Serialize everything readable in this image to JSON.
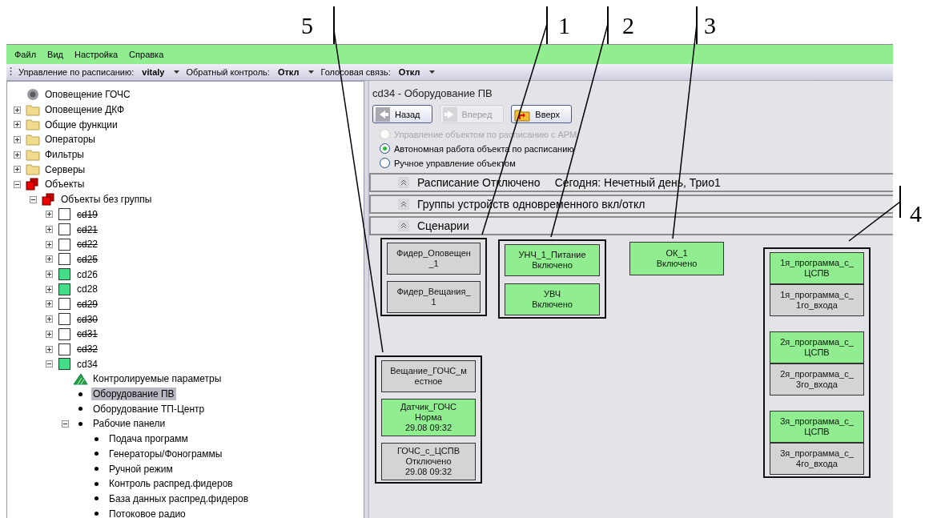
{
  "menu": [
    "Файл",
    "Вид",
    "Настройка",
    "Справка"
  ],
  "toolbar": [
    {
      "label": "Управление по расписанию:",
      "value": "vitaly"
    },
    {
      "label": "Обратный контроль:",
      "value": "Откл"
    },
    {
      "label": "Голосовая связь:",
      "value": "Откл"
    }
  ],
  "tree": [
    {
      "label": "Оповещение ГОЧС",
      "kind": "speaker",
      "selected": false
    },
    {
      "label": "Оповещение ДКФ",
      "kind": "folder",
      "expanded": false,
      "selected": false
    },
    {
      "label": "Общие функции",
      "kind": "folder",
      "expanded": false,
      "selected": false
    },
    {
      "label": "Операторы",
      "kind": "folder",
      "expanded": false,
      "selected": false
    },
    {
      "label": "Фильтры",
      "kind": "folder",
      "expanded": false,
      "selected": false
    },
    {
      "label": "Серверы",
      "kind": "folder",
      "expanded": false,
      "selected": false
    },
    {
      "label": "Объекты",
      "kind": "cubes",
      "expanded": true,
      "selected": false,
      "children": [
        {
          "label": "Объекты без группы",
          "kind": "cubes",
          "expanded": true,
          "selected": false,
          "children": [
            {
              "label": "cd19",
              "kind": "square",
              "color": "#ffffff",
              "disabled": true,
              "expanded": false,
              "selected": false
            },
            {
              "label": "cd21",
              "kind": "square",
              "color": "#ffffff",
              "disabled": true,
              "expanded": false,
              "selected": false
            },
            {
              "label": "cd22",
              "kind": "square",
              "color": "#ffffff",
              "disabled": true,
              "expanded": false,
              "selected": false
            },
            {
              "label": "cd25",
              "kind": "square",
              "color": "#ffffff",
              "disabled": true,
              "expanded": false,
              "selected": false
            },
            {
              "label": "cd26",
              "kind": "square",
              "color": "#44dd88",
              "disabled": false,
              "expanded": false,
              "selected": false
            },
            {
              "label": "cd28",
              "kind": "square",
              "color": "#44dd88",
              "disabled": false,
              "expanded": false,
              "selected": false
            },
            {
              "label": "cd29",
              "kind": "square",
              "color": "#ffffff",
              "disabled": true,
              "expanded": false,
              "selected": false
            },
            {
              "label": "cd30",
              "kind": "square",
              "color": "#ffffff",
              "disabled": true,
              "expanded": false,
              "selected": false
            },
            {
              "label": "cd31",
              "kind": "square",
              "color": "#ffffff",
              "disabled": true,
              "expanded": false,
              "selected": false
            },
            {
              "label": "cd32",
              "kind": "square",
              "color": "#ffffff",
              "disabled": true,
              "expanded": false,
              "selected": false
            },
            {
              "label": "cd34",
              "kind": "square",
              "color": "#44dd88",
              "disabled": false,
              "expanded": true,
              "selected": false,
              "children": [
                {
                  "label": "Контролируемые параметры",
                  "kind": "params",
                  "selected": false
                },
                {
                  "label": "Оборудование ПВ",
                  "kind": "bullet",
                  "selected": true
                },
                {
                  "label": "Оборудование ТП-Центр",
                  "kind": "bullet",
                  "selected": false
                },
                {
                  "label": "Рабочие панели",
                  "kind": "bullet",
                  "expanded": true,
                  "selected": false,
                  "children": [
                    {
                      "label": "Подача программ",
                      "kind": "bullet",
                      "selected": false
                    },
                    {
                      "label": "Генераторы/Фонограммы",
                      "kind": "bullet",
                      "selected": false
                    },
                    {
                      "label": "Ручной режим",
                      "kind": "bullet",
                      "selected": false
                    },
                    {
                      "label": "Контроль распред.фидеров",
                      "kind": "bullet",
                      "selected": false
                    },
                    {
                      "label": "База данных распред.фидеров",
                      "kind": "bullet",
                      "selected": false
                    },
                    {
                      "label": "Потоковое радио",
                      "kind": "bullet",
                      "selected": false
                    }
                  ]
                }
              ]
            }
          ]
        }
      ]
    }
  ],
  "panel": {
    "title": "cd34 - Оборудование ПВ",
    "nav_buttons": [
      {
        "kind": "back",
        "label": "Назад",
        "disabled": false
      },
      {
        "kind": "forward",
        "label": "Вперед",
        "disabled": true
      },
      {
        "kind": "up",
        "label": "Вверх",
        "disabled": false
      }
    ],
    "modes": [
      {
        "label": "Управление объектом по расписанию с АРМ",
        "selected": false,
        "disabled": true
      },
      {
        "label": "Автономная работа объекта по расписанию",
        "selected": true,
        "disabled": false
      },
      {
        "label": "Ручное управление объектом",
        "selected": false,
        "disabled": false
      }
    ],
    "sections": [
      {
        "title": "Расписание Отключено",
        "info": "Сегодня: Нечетный день, Трио1"
      },
      {
        "title": "Группы устройств одновременного вкл/откл"
      },
      {
        "title": "Сценарии"
      }
    ],
    "device_groups": [
      {
        "framed": true,
        "stacks": [
          [
            {
              "lines": [
                "Фидер_Оповещен",
                "_1"
              ],
              "on": false
            }
          ],
          [
            {
              "lines": [
                "Фидер_Вещания_",
                "1"
              ],
              "on": false
            }
          ]
        ]
      },
      {
        "framed": true,
        "stacks": [
          [
            {
              "lines": [
                "УНЧ_1_Питание",
                "Включено"
              ],
              "on": true
            }
          ],
          [
            {
              "lines": [
                "УВЧ",
                "Включено"
              ],
              "on": true
            }
          ]
        ]
      },
      {
        "framed": false,
        "stacks": [
          [
            {
              "lines": [
                "ОК_1",
                "Включено"
              ],
              "on": true
            }
          ]
        ]
      },
      {
        "framed": true,
        "stacks": [
          [
            {
              "lines": [
                "1я_программа_с_",
                "ЦСПВ"
              ],
              "on": true
            },
            {
              "lines": [
                "1я_программа_с_",
                "1го_входа"
              ],
              "on": false
            }
          ],
          [
            {
              "lines": [
                "2я_программа_с_",
                "ЦСПВ"
              ],
              "on": true
            },
            {
              "lines": [
                "2я_программа_с_",
                "3го_входа"
              ],
              "on": false
            }
          ],
          [
            {
              "lines": [
                "3я_программа_с_",
                "ЦСПВ"
              ],
              "on": true
            },
            {
              "lines": [
                "3я_программа_с_",
                "4го_входа"
              ],
              "on": false
            }
          ]
        ]
      },
      {
        "framed": true,
        "stacks": [
          [
            {
              "lines": [
                "Вещание_ГОЧС_м",
                "естное"
              ],
              "on": false
            }
          ],
          [
            {
              "lines": [
                "Датчик_ГОЧС",
                "Норма",
                "29.08 09:32"
              ],
              "on": true
            }
          ],
          [
            {
              "lines": [
                "ГОЧС_с_ЦСПВ",
                "Отключено",
                "29.08 09:32"
              ],
              "on": false
            }
          ]
        ]
      }
    ]
  },
  "callouts": [
    {
      "label": "5"
    },
    {
      "label": "1"
    },
    {
      "label": "2"
    },
    {
      "label": "3"
    },
    {
      "label": "4"
    }
  ]
}
